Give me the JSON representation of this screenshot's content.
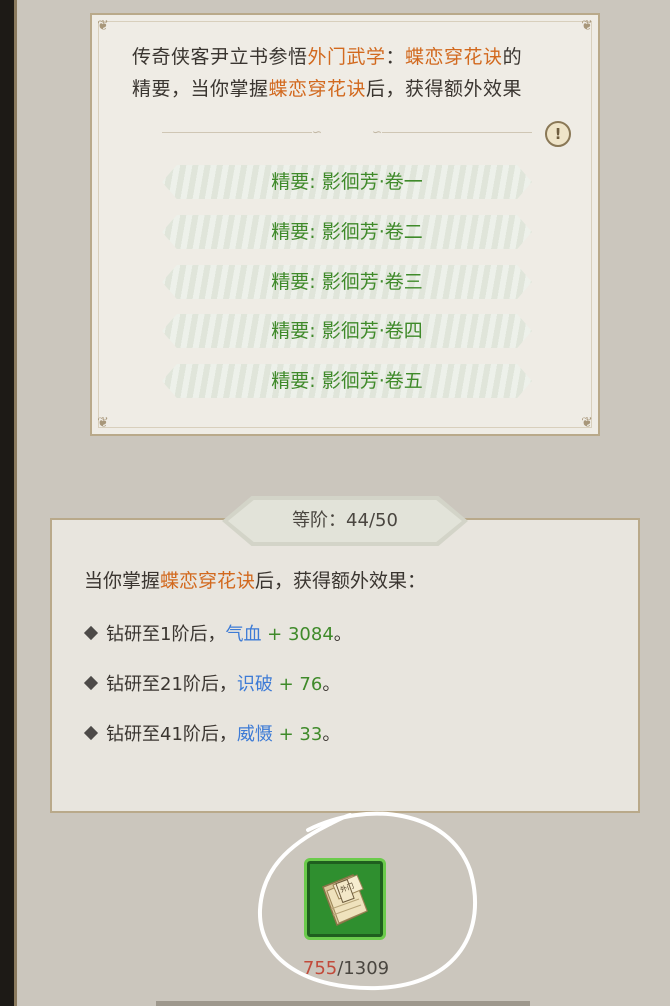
{
  "description": {
    "part1": "传奇侠客尹立书参悟",
    "school": "外门武学",
    "colon": "：",
    "skill": "蝶恋穿花诀",
    "part2": "的",
    "part3": "精要，当你掌握",
    "skill2": "蝶恋穿花诀",
    "part4": "后，获得额外效果"
  },
  "info_icon": "!",
  "essences": [
    "精要: 影徊芳·卷一",
    "精要: 影徊芳·卷二",
    "精要: 影徊芳·卷三",
    "精要: 影徊芳·卷四",
    "精要: 影徊芳·卷五"
  ],
  "grade": {
    "label": "等阶：44/50"
  },
  "bonus": {
    "intro_a": "当你掌握",
    "intro_skill": "蝶恋穿花诀",
    "intro_b": "后，获得额外效果：",
    "items": [
      {
        "prefix": "钻研至1阶后，",
        "stat": "气血",
        "value": " + 3084",
        "end": "。"
      },
      {
        "prefix": "钻研至21阶后，",
        "stat": "识破",
        "value": " + 76",
        "end": "。"
      },
      {
        "prefix": "钻研至41阶后，",
        "stat": "威慑",
        "value": " + 33",
        "end": "。"
      }
    ]
  },
  "item": {
    "icon_text": "外门",
    "owned": "755",
    "required": "/1309"
  },
  "colors": {
    "orange": "#d2691e",
    "green": "#3f8a2a",
    "blue": "#3d7bd6",
    "item_border": "#6bcb4c"
  }
}
